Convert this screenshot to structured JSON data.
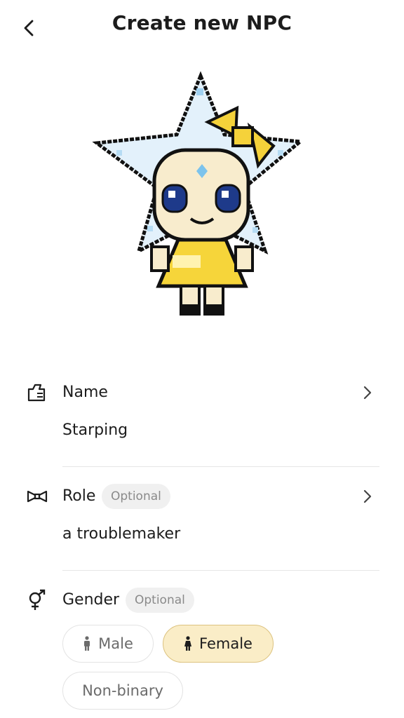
{
  "header": {
    "title": "Create new NPC",
    "back_icon": "chevron-left-icon"
  },
  "avatar": {
    "description_icon": "pixel-star-character"
  },
  "fields": {
    "name": {
      "label": "Name",
      "value": "Starping",
      "icon": "name-tag-icon"
    },
    "role": {
      "label": "Role",
      "optional_label": "Optional",
      "value": "a troublemaker",
      "icon": "bow-tie-icon"
    },
    "gender": {
      "label": "Gender",
      "optional_label": "Optional",
      "icon": "gender-symbol-icon",
      "options": [
        {
          "label": "Male",
          "selected": false
        },
        {
          "label": "Female",
          "selected": true
        },
        {
          "label": "Non-binary",
          "selected": false
        }
      ]
    }
  },
  "colors": {
    "selected_chip_bg": "#faedc7",
    "selected_chip_border": "#dcc27f",
    "pill_bg": "#f0f0f0",
    "divider": "#e6e6e6"
  }
}
